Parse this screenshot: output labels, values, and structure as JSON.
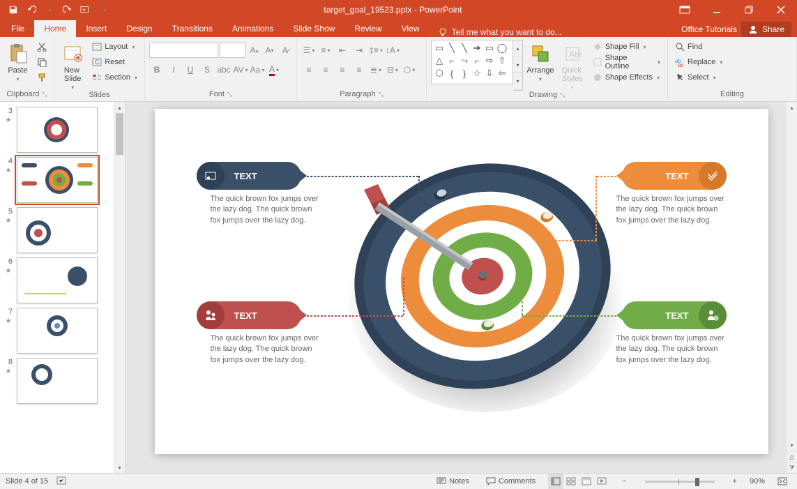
{
  "titlebar": {
    "filename": "target_goal_19523.pptx - PowerPoint"
  },
  "tabs": {
    "file": "File",
    "items": [
      "Home",
      "Insert",
      "Design",
      "Transitions",
      "Animations",
      "Slide Show",
      "Review",
      "View"
    ],
    "active": "Home",
    "tell_me": "Tell me what you want to do...",
    "office_tutorials": "Office Tutorials",
    "share": "Share"
  },
  "ribbon": {
    "clipboard": {
      "label": "Clipboard",
      "paste": "Paste"
    },
    "slides": {
      "label": "Slides",
      "new_slide": "New\nSlide",
      "layout": "Layout",
      "reset": "Reset",
      "section": "Section"
    },
    "font": {
      "label": "Font"
    },
    "paragraph": {
      "label": "Paragraph"
    },
    "drawing": {
      "label": "Drawing",
      "arrange": "Arrange",
      "quick_styles": "Quick\nStyles",
      "shape_fill": "Shape Fill",
      "shape_outline": "Shape Outline",
      "shape_effects": "Shape Effects"
    },
    "editing": {
      "label": "Editing",
      "find": "Find",
      "replace": "Replace",
      "select": "Select"
    }
  },
  "thumbs": [
    {
      "n": "3"
    },
    {
      "n": "4",
      "selected": true
    },
    {
      "n": "5"
    },
    {
      "n": "6"
    },
    {
      "n": "7"
    },
    {
      "n": "8"
    }
  ],
  "slide": {
    "callouts": {
      "tl": {
        "title": "TEXT",
        "desc": "The quick brown fox jumps over the lazy dog. The quick brown fox jumps over the lazy dog."
      },
      "bl": {
        "title": "TEXT",
        "desc": "The quick brown fox jumps over the lazy dog. The quick brown fox jumps over the lazy dog."
      },
      "tr": {
        "title": "TEXT",
        "desc": "The quick brown fox jumps over the lazy dog. The quick brown fox jumps over the lazy dog."
      },
      "br": {
        "title": "TEXT",
        "desc": "The quick brown fox jumps over the lazy dog. The quick brown fox jumps over the lazy dog."
      }
    },
    "colors": {
      "navy": "#3a4f68",
      "red": "#c0504d",
      "orange": "#ed8c3a",
      "green": "#70ad47",
      "white": "#ffffff"
    }
  },
  "status": {
    "slide": "Slide 4 of 15",
    "notes": "Notes",
    "comments": "Comments",
    "zoom": "90%"
  }
}
